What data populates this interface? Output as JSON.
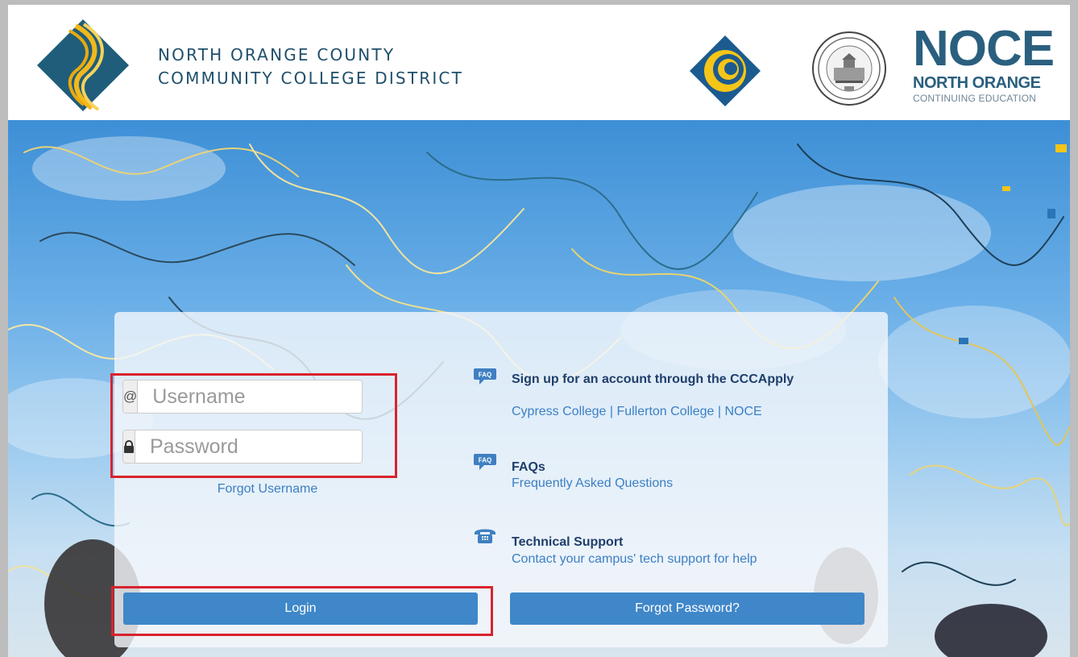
{
  "header": {
    "district_line1": "NORTH ORANGE COUNTY",
    "district_line2": "COMMUNITY COLLEGE DISTRICT",
    "noce_big": "NOCE",
    "noce_line1": "NORTH ORANGE",
    "noce_line2": "CONTINUING EDUCATION"
  },
  "login": {
    "username_addon": "@",
    "username_placeholder": "Username",
    "password_placeholder": "Password",
    "forgot_username": "Forgot Username",
    "login_button": "Login",
    "forgot_password_button": "Forgot Password?"
  },
  "info": {
    "signup_title": "Sign up for an account through the CCCApply",
    "signup_links": [
      "Cypress College",
      "Fullerton College",
      "NOCE"
    ],
    "signup_separator": " | ",
    "faq_title": "FAQs",
    "faq_sub": "Frequently Asked Questions",
    "tech_title": "Technical Support",
    "tech_sub": "Contact your campus' tech support for help"
  },
  "icons": {
    "faq_bubble": "FAQ",
    "colors": {
      "district_blue": "#1f5d7a",
      "district_gold": "#f2b81b",
      "cypress_blue": "#1c5b8f",
      "cypress_gold": "#f5c518",
      "button_blue": "#3f87c9",
      "highlight_red": "#d9232e"
    }
  }
}
